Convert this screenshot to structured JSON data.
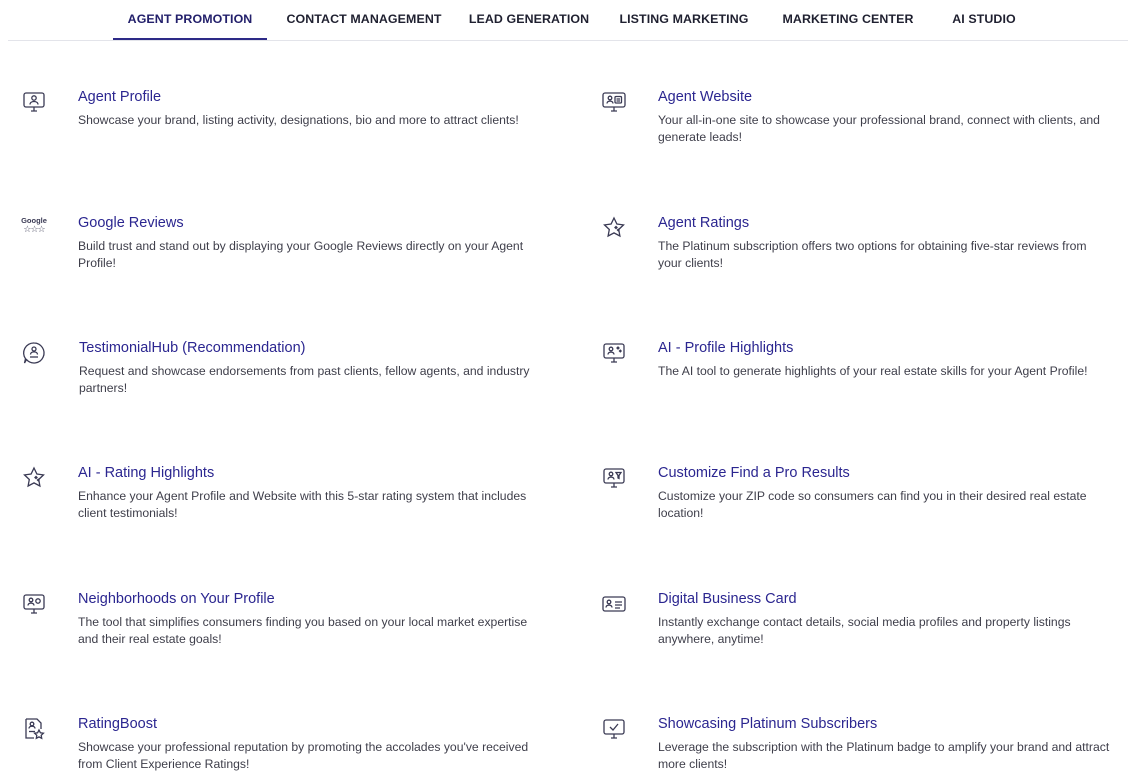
{
  "nav": {
    "tabs": [
      {
        "label": "AGENT PROMOTION",
        "active": true
      },
      {
        "label": "CONTACT MANAGEMENT",
        "active": false
      },
      {
        "label": "LEAD GENERATION",
        "active": false
      },
      {
        "label": "LISTING MARKETING",
        "active": false
      },
      {
        "label": "MARKETING CENTER",
        "active": false
      },
      {
        "label": "AI STUDIO",
        "active": false
      }
    ]
  },
  "features": {
    "left": [
      {
        "title": "Agent Profile",
        "desc": "Showcase your brand, listing activity, designations, bio and more to attract clients!"
      },
      {
        "title": "Google Reviews",
        "desc": "Build trust and stand out by displaying your Google Reviews directly on your Agent Profile!",
        "icon_text": "Google",
        "icon_stars": "☆☆☆"
      },
      {
        "title": "TestimonialHub (Recommendation)",
        "desc": "Request and showcase endorsements from past clients, fellow agents, and industry partners!"
      },
      {
        "title": "AI - Rating Highlights",
        "desc": "Enhance your Agent Profile and Website with this 5-star rating system that includes client testimonials!"
      },
      {
        "title": "Neighborhoods on Your Profile",
        "desc": "The tool that simplifies consumers finding you based on your local market expertise and their real estate goals!"
      },
      {
        "title": "RatingBoost",
        "desc": "Showcase your professional reputation by promoting the accolades you've received from Client Experience Ratings!"
      }
    ],
    "right": [
      {
        "title": "Agent Website",
        "desc": "Your all-in-one site to showcase your professional brand, connect with clients, and generate leads!"
      },
      {
        "title": "Agent Ratings",
        "desc": "The Platinum subscription offers two options for obtaining five-star reviews from your clients!"
      },
      {
        "title": "AI - Profile Highlights",
        "desc": "The AI tool to generate highlights of your real estate skills for your Agent Profile!"
      },
      {
        "title": "Customize Find a Pro Results",
        "desc": "Customize your ZIP code so consumers can find you in their desired real estate location!"
      },
      {
        "title": "Digital Business Card",
        "desc": "Instantly exchange contact details, social media profiles and property listings anywhere, anytime!"
      },
      {
        "title": "Showcasing Platinum Subscribers",
        "desc": "Leverage the subscription with the Platinum badge to amplify your brand and attract more clients!"
      }
    ]
  }
}
